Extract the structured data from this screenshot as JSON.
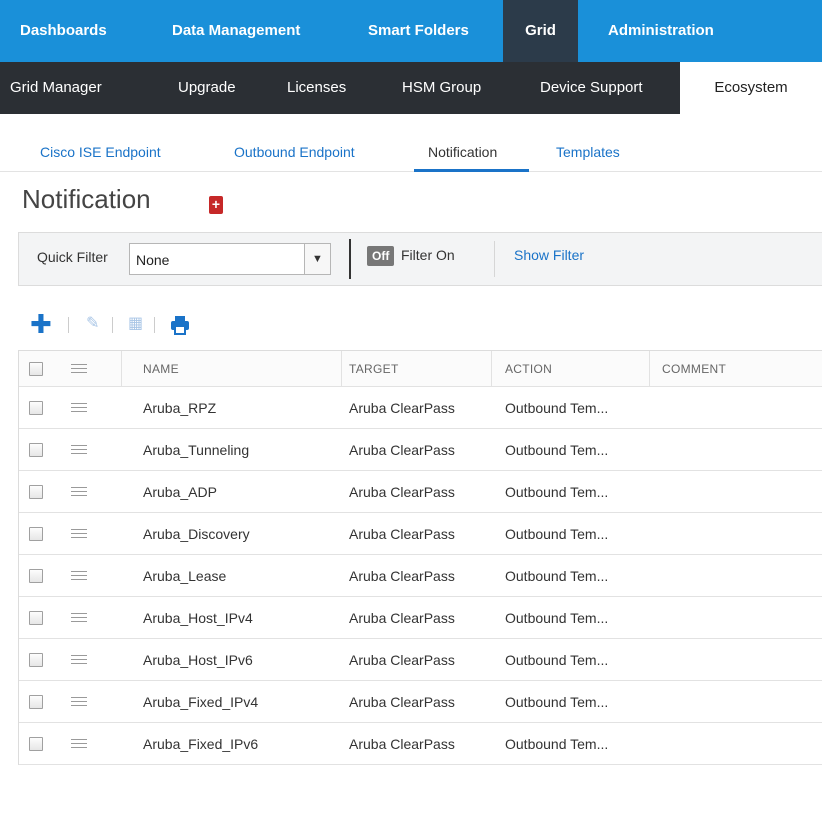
{
  "topnav": {
    "items": [
      {
        "label": "Dashboards",
        "active": false
      },
      {
        "label": "Data Management",
        "active": false
      },
      {
        "label": "Smart Folders",
        "active": false
      },
      {
        "label": "Grid",
        "active": true
      },
      {
        "label": "Administration",
        "active": false
      }
    ]
  },
  "subnav": {
    "items": [
      {
        "label": "Grid Manager",
        "active": false
      },
      {
        "label": "Upgrade",
        "active": false
      },
      {
        "label": "Licenses",
        "active": false
      },
      {
        "label": "HSM Group",
        "active": false
      },
      {
        "label": "Device Support",
        "active": false
      },
      {
        "label": "Ecosystem",
        "active": true
      }
    ]
  },
  "tabs": [
    {
      "label": "Cisco ISE Endpoint",
      "active": false
    },
    {
      "label": "Outbound Endpoint",
      "active": false
    },
    {
      "label": "Notification",
      "active": true
    },
    {
      "label": "Templates",
      "active": false
    }
  ],
  "page": {
    "title": "Notification"
  },
  "filter": {
    "quick_filter_label": "Quick Filter",
    "quick_filter_value": "None",
    "off_badge": "Off",
    "filter_on_label": "Filter On",
    "show_filter_label": "Show Filter"
  },
  "toolbar": {
    "add_icon": "plus-icon",
    "edit_icon": "edit-icon",
    "delete_icon": "trash-icon",
    "print_icon": "print-icon"
  },
  "table": {
    "columns": [
      "NAME",
      "TARGET",
      "ACTION",
      "COMMENT"
    ],
    "rows": [
      {
        "name": "Aruba_RPZ",
        "target": "Aruba ClearPass",
        "action": "Outbound Tem...",
        "comment": ""
      },
      {
        "name": "Aruba_Tunneling",
        "target": "Aruba ClearPass",
        "action": "Outbound Tem...",
        "comment": ""
      },
      {
        "name": "Aruba_ADP",
        "target": "Aruba ClearPass",
        "action": "Outbound Tem...",
        "comment": ""
      },
      {
        "name": "Aruba_Discovery",
        "target": "Aruba ClearPass",
        "action": "Outbound Tem...",
        "comment": ""
      },
      {
        "name": "Aruba_Lease",
        "target": "Aruba ClearPass",
        "action": "Outbound Tem...",
        "comment": ""
      },
      {
        "name": "Aruba_Host_IPv4",
        "target": "Aruba ClearPass",
        "action": "Outbound Tem...",
        "comment": ""
      },
      {
        "name": "Aruba_Host_IPv6",
        "target": "Aruba ClearPass",
        "action": "Outbound Tem...",
        "comment": ""
      },
      {
        "name": "Aruba_Fixed_IPv4",
        "target": "Aruba ClearPass",
        "action": "Outbound Tem...",
        "comment": ""
      },
      {
        "name": "Aruba_Fixed_IPv6",
        "target": "Aruba ClearPass",
        "action": "Outbound Tem...",
        "comment": ""
      }
    ]
  },
  "colors": {
    "topnav_bg": "#1a90d9",
    "subnav_bg": "#2b2f34",
    "link": "#1a73c8",
    "bookmark": "#c62828"
  }
}
